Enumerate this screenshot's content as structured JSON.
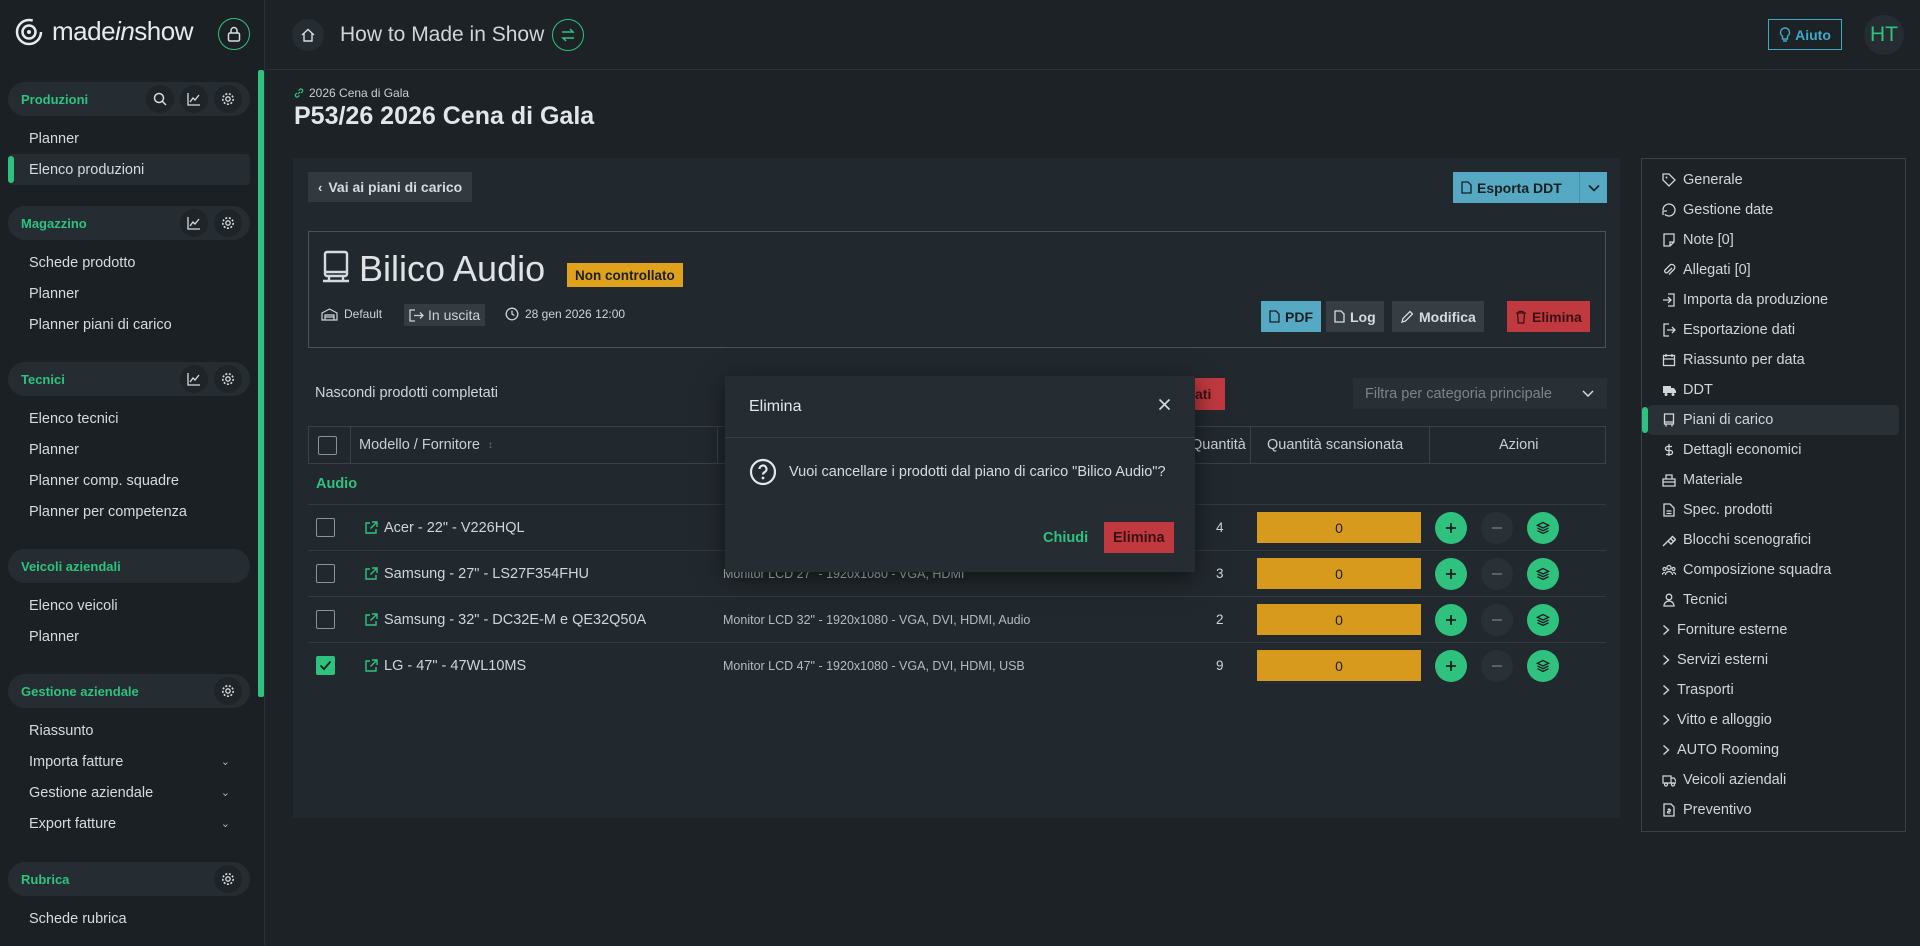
{
  "brand": {
    "name_pre": "made",
    "name_italic": "in",
    "name_post": "show"
  },
  "sidebar": {
    "groups": [
      {
        "title": "Produzioni",
        "items": [
          "Planner",
          "Elenco produzioni"
        ]
      },
      {
        "title": "Magazzino",
        "items": [
          "Schede prodotto",
          "Planner",
          "Planner piani di carico"
        ]
      },
      {
        "title": "Tecnici",
        "items": [
          "Elenco tecnici",
          "Planner",
          "Planner comp. squadre",
          "Planner per competenza"
        ]
      },
      {
        "title": "Veicoli aziendali",
        "items": [
          "Elenco veicoli",
          "Planner"
        ]
      },
      {
        "title": "Gestione aziendale",
        "items": [
          "Riassunto",
          "Importa fatture",
          "Gestione aziendale",
          "Export fatture"
        ]
      },
      {
        "title": "Rubrica",
        "items": [
          "Schede rubrica"
        ]
      }
    ]
  },
  "topbar": {
    "title": "How to Made in Show",
    "help_label": "Aiuto",
    "avatar_initials": "HT"
  },
  "breadcrumb": "2026 Cena di Gala",
  "page_title": "P53/26 2026 Cena di Gala",
  "main": {
    "back_label": "Vai ai piani di carico",
    "export_label": "Esporta DDT",
    "card": {
      "title": "Bilico Audio",
      "status": "Non controllato",
      "warehouse": "Default",
      "direction": "In uscita",
      "datetime": "28 gen 2026 12:00",
      "actions": {
        "pdf": "PDF",
        "log": "Log",
        "edit": "Modifica",
        "delete": "Elimina"
      }
    },
    "hide_completed_label": "Nascondi prodotti completati",
    "peek_button_text": "ati",
    "filter_placeholder": "Filtra per categoria principale",
    "table": {
      "headers": {
        "model": "Modello / Fornitore",
        "qty": "Quantità",
        "scanned": "Quantità scansionata",
        "actions": "Azioni"
      },
      "group": "Audio",
      "rows": [
        {
          "name": "Acer - 22\" - V226HQL",
          "desc": "",
          "qty": "4",
          "scanned": "0",
          "checked": false
        },
        {
          "name": "Samsung - 27\" - LS27F354FHU",
          "desc": "Monitor LCD 27\" - 1920x1080 - VGA, HDMI",
          "qty": "3",
          "scanned": "0",
          "checked": false
        },
        {
          "name": "Samsung - 32\" - DC32E-M e QE32Q50A",
          "desc": "Monitor LCD 32\" - 1920x1080 - VGA, DVI, HDMI, Audio",
          "qty": "2",
          "scanned": "0",
          "checked": false
        },
        {
          "name": "LG - 47\" - 47WL10MS",
          "desc": "Monitor LCD 47\" - 1920x1080 - VGA, DVI, HDMI, USB",
          "qty": "9",
          "scanned": "0",
          "checked": true
        }
      ]
    }
  },
  "right_menu": [
    "Generale",
    "Gestione date",
    "Note [0]",
    "Allegati [0]",
    "Importa da produzione",
    "Esportazione dati",
    "Riassunto per data",
    "DDT",
    "Piani di carico",
    "Dettagli economici",
    "Materiale",
    "Spec. prodotti",
    "Blocchi scenografici",
    "Composizione squadra",
    "Tecnici",
    "Forniture esterne",
    "Servizi esterni",
    "Trasporti",
    "Vitto e alloggio",
    "AUTO Rooming",
    "Veicoli aziendali",
    "Preventivo"
  ],
  "modal": {
    "title": "Elimina",
    "message": "Vuoi cancellare i prodotti dal piano di carico \"Bilico Audio\"?",
    "cancel_label": "Chiudi",
    "confirm_label": "Elimina"
  },
  "colors": {
    "accent": "#2ec27e",
    "info": "#56a9c3",
    "warning": "#e0a21b",
    "danger": "#c0393f",
    "background": "#1d2226"
  }
}
